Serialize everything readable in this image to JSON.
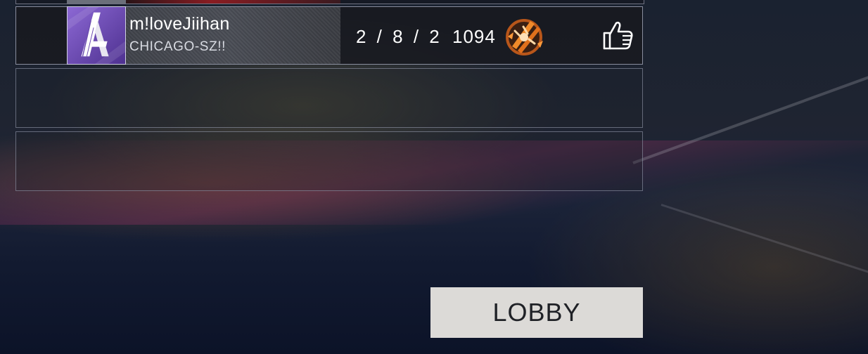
{
  "scoreboard": {
    "player": {
      "name": "m!loveJiihan",
      "club": "CHICAGO-SZ!!",
      "goals_assists_saves": "2 / 8 / 2",
      "score": "1094",
      "avatar_icon": "letter-a-avatar-icon",
      "rank_icon": "rank-badge-icon",
      "like_icon": "thumbs-up-icon"
    },
    "empty_slots": 2
  },
  "actions": {
    "lobby_label": "LOBBY"
  },
  "colors": {
    "avatar_bg": "#7a56c4",
    "lobby_button_bg": "#dcdad7",
    "rank_accent": "#e07a1f"
  }
}
